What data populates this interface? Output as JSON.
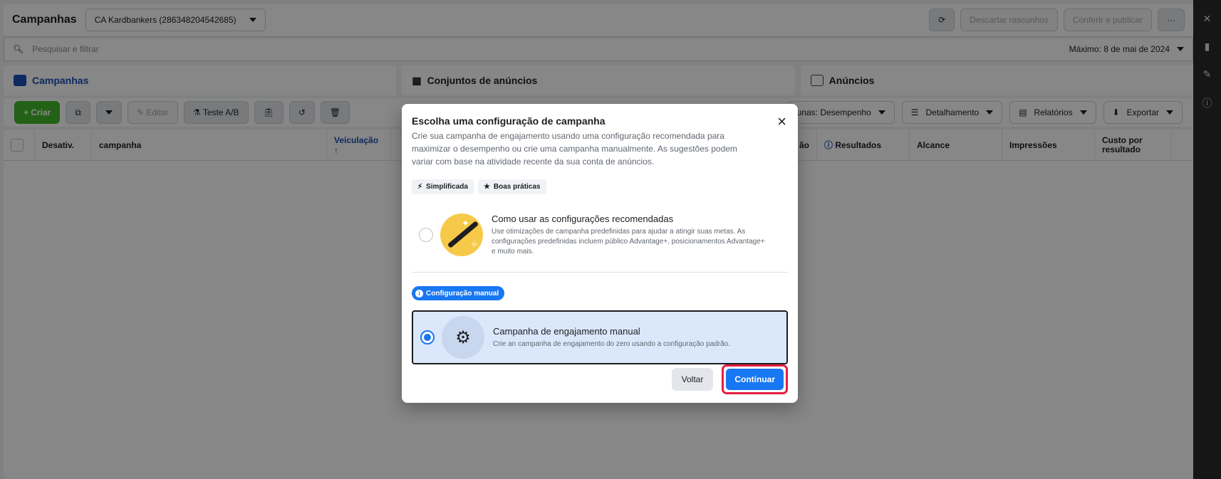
{
  "header": {
    "title": "Campanhas",
    "account": "CA Kardbankers (286348204542685)",
    "discard_label": "Descartar rascunhos",
    "review_label": "Conferir e publicar",
    "more_label": "···"
  },
  "search": {
    "placeholder": "Pesquisar e filtrar",
    "date_range": "Máximo: 8 de mai de 2024"
  },
  "tabs": [
    {
      "label": "Campanhas"
    },
    {
      "label": "Conjuntos de anúncios"
    },
    {
      "label": "Anúncios"
    }
  ],
  "toolbar": {
    "create_label": "+ Criar",
    "edit_label": "Editar",
    "ab_test_label": "Teste A/B",
    "columns_label": "unas: Desempenho",
    "breakdown_label": "Detalhamento",
    "reports_label": "Relatórios",
    "export_label": "Exportar"
  },
  "table": {
    "columns": [
      "Desativ.",
      "campanha",
      "Veiculação ↑",
      "ão",
      "Resultados",
      "Alcance",
      "Impressões",
      "Custo por resultado"
    ]
  },
  "modal": {
    "title": "Escolha uma configuração de campanha",
    "description": "Crie sua campanha de engajamento usando uma configuração recomendada para maximizar o desempenho ou crie uma campanha manualmente. As sugestões podem variar com base na atividade recente da sua conta de anúncios.",
    "chips": [
      "Simplificada",
      "Boas práticas"
    ],
    "option_recommended": {
      "title": "Como usar as configurações recomendadas",
      "description": "Use otimizações de campanha predefinidas para ajudar a atingir suas metas. As configurações predefinidas incluem público Advantage+, posicionamentos Advantage+ e muito mais."
    },
    "manual_badge": "Configuração manual",
    "option_manual": {
      "title": "Campanha de engajamento manual",
      "description": "Crie an campanha de engajamento do zero usando a configuração padrão."
    },
    "back_label": "Voltar",
    "continue_label": "Continuar"
  }
}
